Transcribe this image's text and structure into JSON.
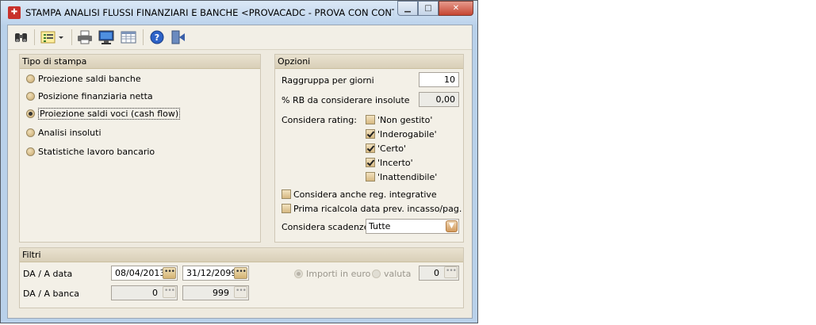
{
  "window": {
    "title": "STAMPA ANALISI FLUSSI FINANZIARI E BANCHE <PROVACADC - PROVA CON CONT...",
    "controls": {
      "minimize": "▁",
      "maximize": "□",
      "close": "✕"
    }
  },
  "toolbar": {
    "icons": [
      "binoculars-icon",
      "list-options-icon",
      "printer-icon",
      "monitor-icon",
      "grid-icon",
      "help-icon",
      "exit-icon"
    ]
  },
  "tipo_stampa": {
    "heading": "Tipo di stampa",
    "options": [
      {
        "label": "Proiezione saldi banche",
        "selected": false
      },
      {
        "label": "Posizione finanziaria netta",
        "selected": false
      },
      {
        "label": "Proiezione saldi voci (cash flow)",
        "selected": true
      },
      {
        "label": "Analisi insoluti",
        "selected": false
      },
      {
        "label": "Statistiche lavoro bancario",
        "selected": false
      }
    ]
  },
  "opzioni": {
    "heading": "Opzioni",
    "raggruppa_label": "Raggruppa per giorni",
    "raggruppa_value": "10",
    "rb_label": "% RB da considerare insolute",
    "rb_value": "0,00",
    "rating_label": "Considera rating:",
    "ratings": [
      {
        "label": "'Non gestito'",
        "checked": false
      },
      {
        "label": "'Inderogabile'",
        "checked": true
      },
      {
        "label": "'Certo'",
        "checked": true
      },
      {
        "label": "'Incerto'",
        "checked": true
      },
      {
        "label": "'Inattendibile'",
        "checked": false
      }
    ],
    "reg_integrative": {
      "label": "Considera anche reg. integrative",
      "checked": false
    },
    "ricalcola": {
      "label": "Prima ricalcola data prev. incasso/pag.",
      "checked": false
    },
    "scadenze_label": "Considera scadenze",
    "scadenze_value": "Tutte"
  },
  "filtri": {
    "heading": "Filtri",
    "data_label": "DA / A data",
    "data_from": "08/04/2013",
    "data_to": "31/12/2099",
    "banca_label": "DA / A banca",
    "banca_from": "0",
    "banca_to": "999",
    "importi_euro": "Importi in euro",
    "valuta": "valuta",
    "valuta_value": "0",
    "dots": "•••"
  },
  "colors": {
    "accent": "#d4b373",
    "panel_head": "#d9cfb8",
    "window_frame": "#b9d1ea"
  }
}
